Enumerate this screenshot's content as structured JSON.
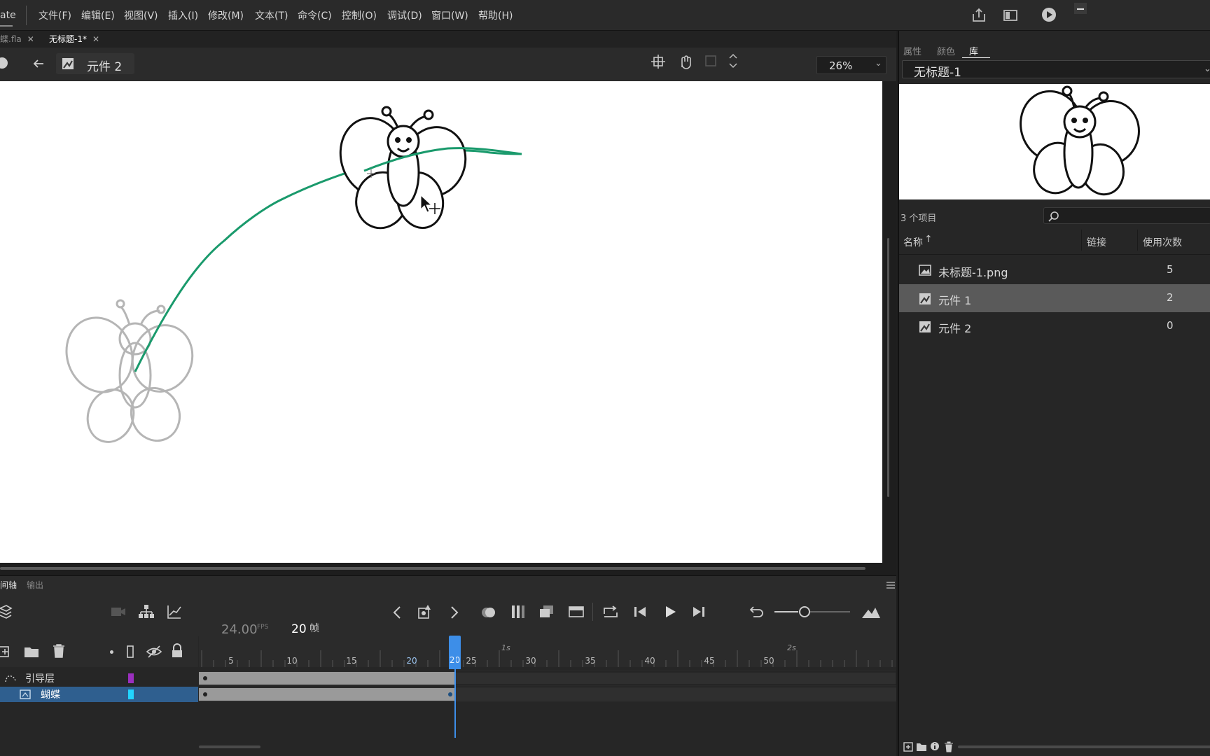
{
  "app": {
    "title_stub": "ate"
  },
  "menu": {
    "items": [
      "文件(F)",
      "编辑(E)",
      "视图(V)",
      "插入(I)",
      "修改(M)",
      "文本(T)",
      "命令(C)",
      "控制(O)",
      "调试(D)",
      "窗口(W)",
      "帮助(H)"
    ]
  },
  "tabs": {
    "items": [
      {
        "label": "蝶.fla",
        "active": false
      },
      {
        "label": "无标题-1*",
        "active": true
      }
    ]
  },
  "editbar": {
    "breadcrumb": "元件 2",
    "zoom": "26%"
  },
  "timeline": {
    "tabs": [
      "间轴",
      "输出"
    ],
    "fps": "24.00",
    "fps_unit": "FPS",
    "current_frame": "20",
    "frame_unit": "帧",
    "ruler_numbers": [
      "5",
      "10",
      "15",
      "20",
      "25",
      "30",
      "35",
      "40",
      "45",
      "50"
    ],
    "ruler_seconds": [
      "1s",
      "2s"
    ],
    "layers": [
      {
        "name": "引导层",
        "color": "#9b2fbf",
        "selected": false
      },
      {
        "name": "蝴蝶",
        "color": "#22d5ff",
        "selected": true
      }
    ]
  },
  "library": {
    "tabs": [
      "属性",
      "颜色",
      "库"
    ],
    "document": "无标题-1",
    "item_count": "3 个项目",
    "columns": {
      "name": "名称",
      "linkage": "链接",
      "use_count": "使用次数"
    },
    "items": [
      {
        "name": "未标题-1.png",
        "count": "5",
        "icon": "image-icon",
        "selected": false
      },
      {
        "name": "元件 1",
        "count": "2",
        "icon": "movieclip-icon",
        "selected": true
      },
      {
        "name": "元件 2",
        "count": "0",
        "icon": "movieclip-icon",
        "selected": false
      }
    ]
  },
  "colors": {
    "accent": "#3d8ee8",
    "guide_path": "#1a9a6c",
    "selected_layer": "#2f5f8f"
  }
}
